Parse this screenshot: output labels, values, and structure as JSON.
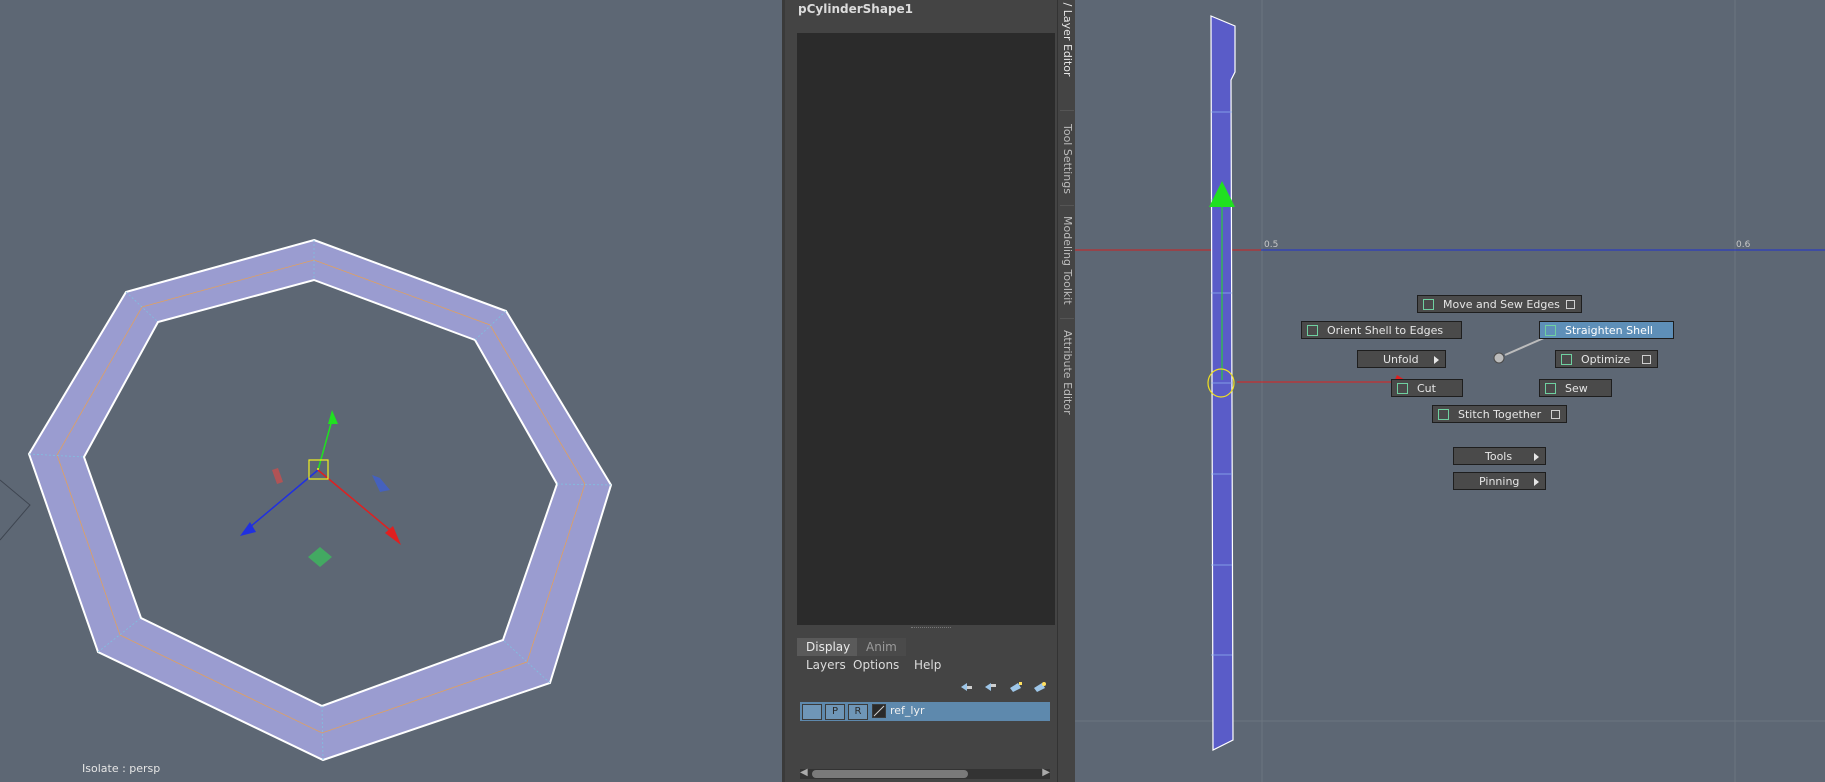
{
  "viewport": {
    "isolate_label": "Isolate : persp"
  },
  "channel_box": {
    "title": "pCylinderShape1"
  },
  "layer_editor": {
    "tabs": [
      {
        "label": "Display",
        "active": true
      },
      {
        "label": "Anim",
        "active": false
      }
    ],
    "menu": [
      "Layers",
      "Options",
      "Help"
    ],
    "layers": [
      {
        "name": "ref_lyr",
        "visible_flag": "",
        "playback_flag": "P",
        "display_type": "R",
        "selected": true
      }
    ]
  },
  "side_tabs": [
    {
      "label": "Channel Box / Layer Editor",
      "active": true
    },
    {
      "label": "Tool Settings",
      "active": false
    },
    {
      "label": "Modeling Toolkit",
      "active": false
    },
    {
      "label": "Attribute Editor",
      "active": false
    }
  ],
  "uv_editor": {
    "tick_labels": [
      "0.5",
      "0.6"
    ],
    "marking_menu": {
      "move_and_sew": "Move and Sew Edges",
      "orient_shell": "Orient Shell to Edges",
      "straighten_shell": "Straighten Shell",
      "unfold": "Unfold",
      "optimize": "Optimize",
      "cut": "Cut",
      "sew": "Sew",
      "stitch_together": "Stitch Together",
      "tools": "Tools",
      "pinning": "Pinning"
    }
  },
  "colors": {
    "viewport_bg": "#5d6774",
    "mesh_fill": "#9a9cd0",
    "uv_shell_fill": "#5a5cc8",
    "highlight": "#5e8fb8",
    "axis_red": "#e02020",
    "axis_green": "#20e020",
    "axis_blue": "#2030e0"
  }
}
